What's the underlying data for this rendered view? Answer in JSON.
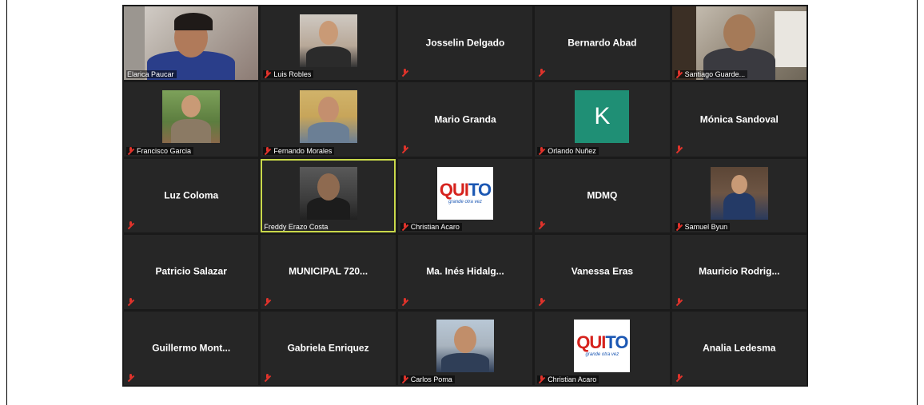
{
  "meeting": {
    "participants": [
      {
        "name": "Elarica Paucar",
        "display": "video",
        "muted": false
      },
      {
        "name": "Luis Robles",
        "display": "photo",
        "muted": true
      },
      {
        "name": "Josselin Delgado",
        "display": "name",
        "muted": true
      },
      {
        "name": "Bernardo Abad",
        "display": "name",
        "muted": true
      },
      {
        "name": "Santiago Guarde...",
        "display": "video",
        "muted": true
      },
      {
        "name": "Francisco Garcia",
        "display": "photo",
        "muted": true
      },
      {
        "name": "Fernando Morales",
        "display": "photo",
        "muted": true
      },
      {
        "name": "Mario Granda",
        "display": "name",
        "muted": true
      },
      {
        "name": "Orlando Nuñez",
        "display": "letter",
        "letter": "K",
        "muted": true
      },
      {
        "name": "Mónica Sandoval",
        "display": "name",
        "muted": true
      },
      {
        "name": "Luz Coloma",
        "display": "name",
        "muted": true
      },
      {
        "name": "Freddy Erazo Costa",
        "display": "photo",
        "muted": false,
        "active_speaker": true
      },
      {
        "name": "Christian Acaro",
        "display": "logo",
        "muted": true
      },
      {
        "name": "MDMQ",
        "display": "name",
        "muted": true
      },
      {
        "name": "Samuel Byun",
        "display": "photo",
        "muted": true
      },
      {
        "name": "Patricio Salazar",
        "display": "name",
        "muted": true
      },
      {
        "name": "MUNICIPAL 720...",
        "display": "name",
        "muted": true
      },
      {
        "name": "Ma. Inés Hidalg...",
        "display": "name",
        "muted": true
      },
      {
        "name": "Vanessa Eras",
        "display": "name",
        "muted": true
      },
      {
        "name": "Mauricio Rodrig...",
        "display": "name",
        "muted": true
      },
      {
        "name": "Guillermo Mont...",
        "display": "name",
        "muted": true
      },
      {
        "name": "Gabriela Enriquez",
        "display": "name",
        "muted": true
      },
      {
        "name": "Carlos Poma",
        "display": "photo",
        "muted": true
      },
      {
        "name": "Christian Acaro",
        "display": "logo",
        "muted": true
      },
      {
        "name": "Analia Ledesma",
        "display": "name",
        "muted": true
      }
    ]
  },
  "logo": {
    "word_red": "QUI",
    "word_blue": "TO",
    "tagline": "grande otra vez"
  },
  "colors": {
    "tile_bg": "#262626",
    "grid_bg": "#1a1a1a",
    "active_border": "#c9d94a",
    "muted_icon": "#e0332b",
    "avatar_letter_bg": "#1f8f75"
  },
  "icons": {
    "muted": "mic-muted-icon"
  }
}
